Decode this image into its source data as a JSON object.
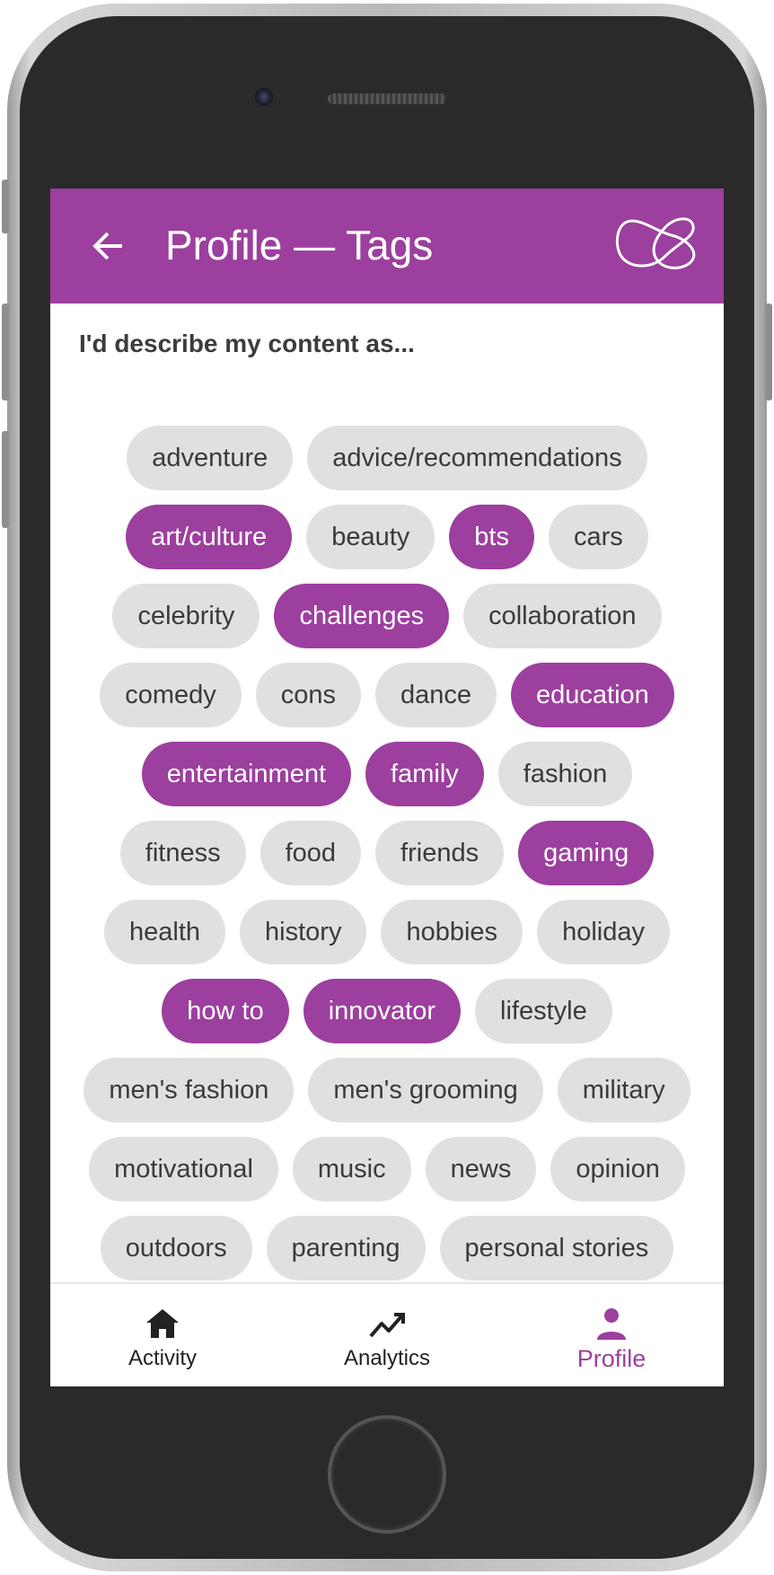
{
  "header": {
    "title": "Profile — Tags"
  },
  "prompt": "I'd describe my content as...",
  "tags": [
    {
      "label": "adventure",
      "selected": false
    },
    {
      "label": "advice/recommendations",
      "selected": false
    },
    {
      "label": "art/culture",
      "selected": true
    },
    {
      "label": "beauty",
      "selected": false
    },
    {
      "label": "bts",
      "selected": true
    },
    {
      "label": "cars",
      "selected": false
    },
    {
      "label": "celebrity",
      "selected": false
    },
    {
      "label": "challenges",
      "selected": true
    },
    {
      "label": "collaboration",
      "selected": false
    },
    {
      "label": "comedy",
      "selected": false
    },
    {
      "label": "cons",
      "selected": false
    },
    {
      "label": "dance",
      "selected": false
    },
    {
      "label": "education",
      "selected": true
    },
    {
      "label": "entertainment",
      "selected": true
    },
    {
      "label": "family",
      "selected": true
    },
    {
      "label": "fashion",
      "selected": false
    },
    {
      "label": "fitness",
      "selected": false
    },
    {
      "label": "food",
      "selected": false
    },
    {
      "label": "friends",
      "selected": false
    },
    {
      "label": "gaming",
      "selected": true
    },
    {
      "label": "health",
      "selected": false
    },
    {
      "label": "history",
      "selected": false
    },
    {
      "label": "hobbies",
      "selected": false
    },
    {
      "label": "holiday",
      "selected": false
    },
    {
      "label": "how to",
      "selected": true
    },
    {
      "label": "innovator",
      "selected": true
    },
    {
      "label": "lifestyle",
      "selected": false
    },
    {
      "label": "men's fashion",
      "selected": false
    },
    {
      "label": "men's grooming",
      "selected": false
    },
    {
      "label": "military",
      "selected": false
    },
    {
      "label": "motivational",
      "selected": false
    },
    {
      "label": "music",
      "selected": false
    },
    {
      "label": "news",
      "selected": false
    },
    {
      "label": "opinion",
      "selected": false
    },
    {
      "label": "outdoors",
      "selected": false
    },
    {
      "label": "parenting",
      "selected": false
    },
    {
      "label": "personal stories",
      "selected": false
    }
  ],
  "bottom_nav": {
    "items": [
      {
        "label": "Activity",
        "icon": "home-icon",
        "active": false
      },
      {
        "label": "Analytics",
        "icon": "trending-icon",
        "active": false
      },
      {
        "label": "Profile",
        "icon": "person-icon",
        "active": true
      }
    ]
  },
  "colors": {
    "accent": "#9c3f9e",
    "tag_bg": "#e0e0e0",
    "tag_text": "#3a3a3a"
  }
}
